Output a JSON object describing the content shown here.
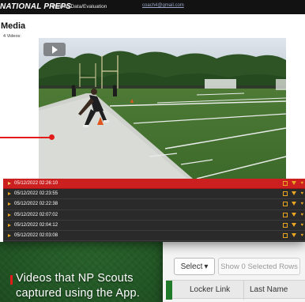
{
  "header": {
    "logo_text": "NATIONAL PREPS",
    "nav_item": "Verified Data/Evaluation",
    "email": "coach4@gmail.com"
  },
  "page": {
    "title": "Media",
    "subtitle": "4 Videos:"
  },
  "videos": [
    {
      "label": "05/12/2022 02:26:10",
      "selected": true
    },
    {
      "label": "05/12/2022 02:23:55",
      "selected": false
    },
    {
      "label": "05/12/2022 02:22:38",
      "selected": false
    },
    {
      "label": "05/12/2022 02:07:02",
      "selected": false
    },
    {
      "label": "05/12/2022 02:04:12",
      "selected": false
    },
    {
      "label": "05/12/2022 02:03:08",
      "selected": false
    }
  ],
  "table": {
    "select_label": "Select",
    "show_selected_label": "Show 0 Selected Rows",
    "columns": [
      "Locker Link",
      "Last Name"
    ]
  },
  "caption": {
    "line1": "Videos that NP Scouts",
    "line2": "captured using the App."
  },
  "colors": {
    "accent_red": "#e21b1b",
    "selected_row": "#cc1f1f",
    "brand_green": "#1f7a2a",
    "action_gold": "#e8a622"
  }
}
